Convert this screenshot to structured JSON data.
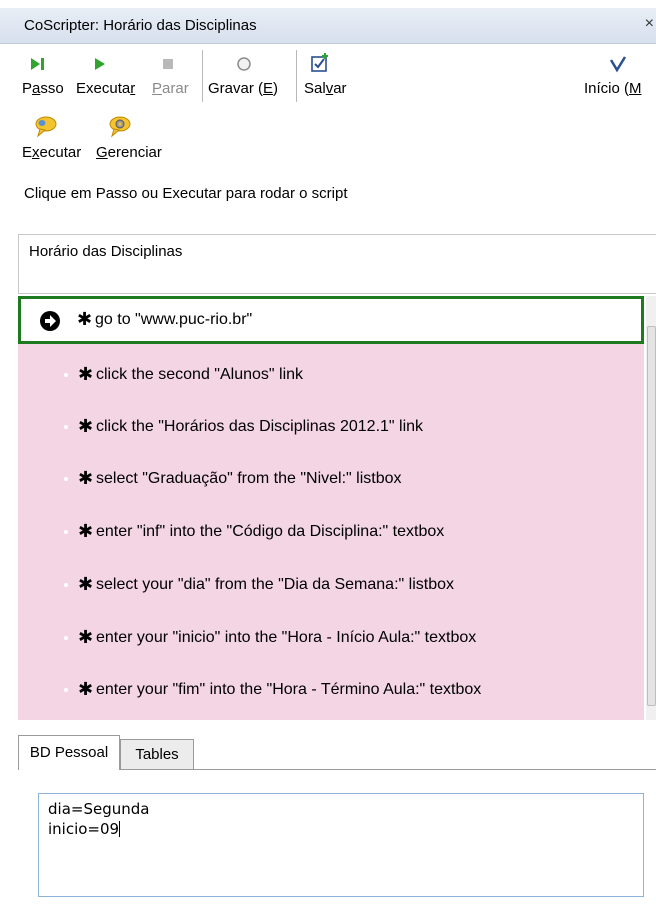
{
  "window": {
    "title": "CoScripter: Horário das Disciplinas",
    "close": "×"
  },
  "toolbar": {
    "step_pre": "P",
    "step_u": "a",
    "step_post": "sso",
    "run_pre": "Executa",
    "run_u": "r",
    "run_post": "",
    "stop_pre": "",
    "stop_u": "P",
    "stop_post": "arar",
    "record_pre": "Gravar (",
    "record_u": "E",
    "record_post": ")",
    "save_pre": "Sal",
    "save_u": "v",
    "save_post": "ar",
    "home_pre": "Início (",
    "home_u": "M"
  },
  "toolbar2": {
    "run_pre": "E",
    "run_u": "x",
    "run_post": "ecutar",
    "manage_pre": "",
    "manage_u": "G",
    "manage_post": "erenciar"
  },
  "status": "Clique em Passo ou Executar para rodar o script",
  "script_title": "Horário das Disciplinas",
  "steps": [
    "go to \"www.puc-rio.br\"",
    "click the second \"Alunos\" link",
    "click the \"Horários das Disciplinas 2012.1\" link",
    "select \"Graduação\" from the \"Nivel:\" listbox",
    "enter \"inf\" into the \"Código da Disciplina:\" textbox",
    "select your \"dia\" from the \"Dia da Semana:\" listbox",
    "enter your \"inicio\" into the \"Hora - Início Aula:\" textbox",
    "enter your \"fim\" into the \"Hora - Término Aula:\" textbox"
  ],
  "step_star": "✱",
  "tabs": {
    "personal": "BD Pessoal",
    "tables": "Tables"
  },
  "personal_db": {
    "line1": "dia=Segunda",
    "line2": "inicio=09"
  },
  "colors": {
    "steps_bg": "#f3d5e4",
    "current_border": "#1e7a1e",
    "run_green": "#2fa52f"
  }
}
